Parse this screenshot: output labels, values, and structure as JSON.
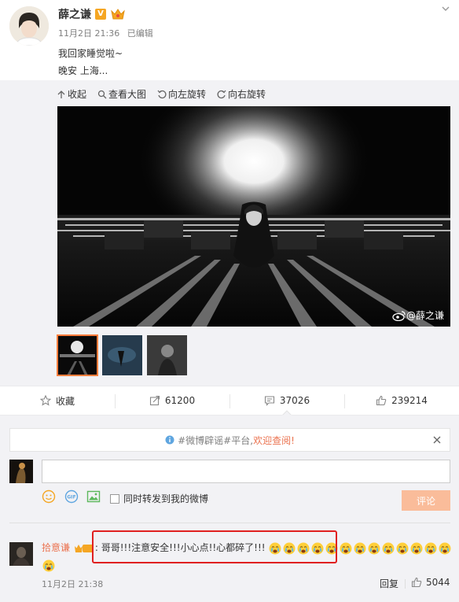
{
  "post": {
    "author": "薛之谦",
    "verified_badge": "V",
    "timestamp": "11月2日 21:36",
    "edited": "已编辑",
    "text_line1": "我回家睡觉啦~",
    "text_line2": "晚安 上海..."
  },
  "media_toolbar": {
    "collapse": "收起",
    "view_large": "查看大图",
    "rotate_left": "向左旋转",
    "rotate_right": "向右旋转"
  },
  "photo": {
    "watermark": "@薛之谦"
  },
  "actions": {
    "favorite": "收藏",
    "forward_count": "61200",
    "comment_count": "37026",
    "like_count": "239214"
  },
  "comment_box": {
    "notice_prefix": "#微博辟谣#平台,",
    "notice_link": "欢迎查阅!",
    "forward_option": "同时转发到我的微博",
    "submit": "评论"
  },
  "comment": {
    "user": "拾意谦",
    "badge_text": "谦粉",
    "text": ": 哥哥!!!注意安全!!!小心点!!心都碎了!!!",
    "timestamp": "11月2日 21:38",
    "reply": "回复",
    "like_count": "5044"
  },
  "colors": {
    "accent": "#eb7350",
    "highlight_box": "#e02020",
    "submit_bg": "#fabc9a"
  }
}
